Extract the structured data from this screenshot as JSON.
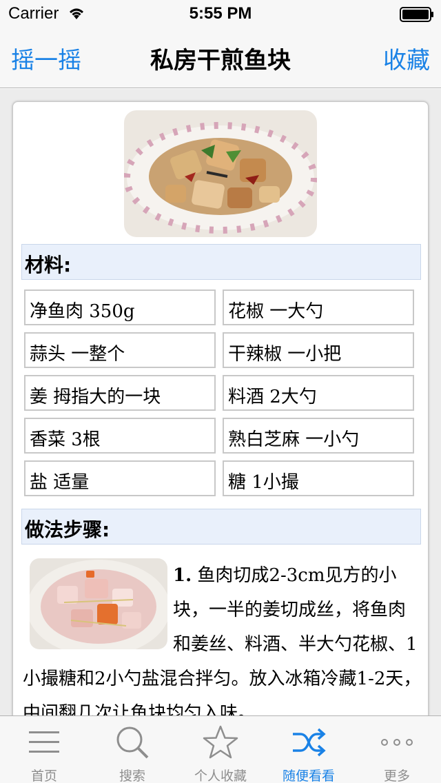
{
  "status_bar": {
    "carrier": "Carrier",
    "time": "5:55 PM"
  },
  "nav": {
    "left_button": "摇一摇",
    "title": "私房干煎鱼块",
    "right_button": "收藏"
  },
  "recipe": {
    "ingredients_heading": "材料:",
    "ingredients": [
      "净鱼肉 350g",
      "花椒 一大勺",
      "蒜头 一整个",
      "干辣椒 一小把",
      "姜 拇指大的一块",
      "料酒 2大勺",
      "香菜 3根",
      "熟白芝麻 一小勺",
      "盐 适量",
      "糖 1小撮"
    ],
    "steps_heading": "做法步骤:",
    "steps": [
      {
        "number": "1.",
        "text": "鱼肉切成2-3cm见方的小块，一半的姜切成丝，将鱼肉和姜丝、料酒、半大勺花椒、1小撮糖和2小勺盐混合拌匀。放入冰箱冷藏1-2天，中间翻几次让鱼块均匀入味。"
      }
    ]
  },
  "tabs": [
    {
      "label": "首页",
      "icon": "menu-lines-icon",
      "active": false
    },
    {
      "label": "搜索",
      "icon": "search-icon",
      "active": false
    },
    {
      "label": "个人收藏",
      "icon": "star-icon",
      "active": false
    },
    {
      "label": "随便看看",
      "icon": "shuffle-icon",
      "active": true
    },
    {
      "label": "更多",
      "icon": "more-dots-icon",
      "active": false
    }
  ],
  "colors": {
    "accent": "#1a82e6",
    "inactive": "#8e8e8e",
    "section_bg": "#e9f0fb"
  }
}
